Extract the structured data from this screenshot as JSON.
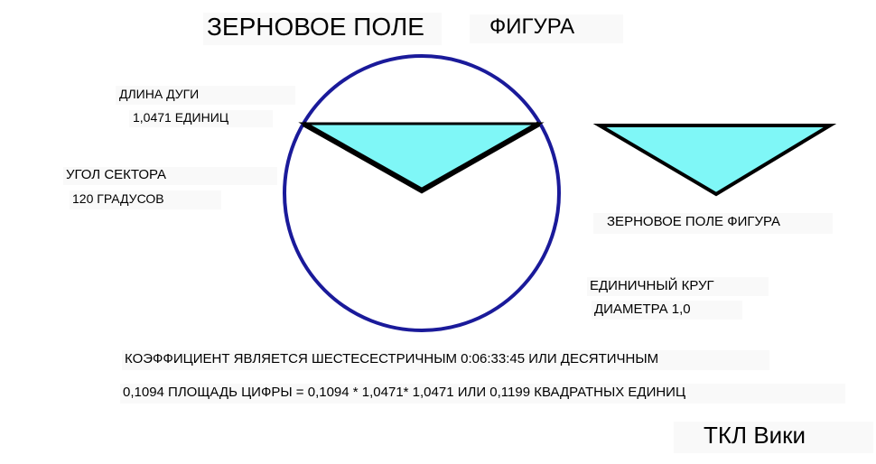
{
  "title": {
    "main": "ЗЕРНОВОЕ ПОЛЕ",
    "sub": "ФИГУРА"
  },
  "labels": {
    "arc_length_label": "ДЛИНА ДУГИ",
    "arc_length_value": "1,0471 ЕДИНИЦ",
    "sector_angle_label": "УГОЛ СЕКТОРА",
    "sector_angle_value": "120 ГРАДУСОВ",
    "figure_caption": "ЗЕРНОВОЕ ПОЛЕ ФИГУРА",
    "unit_circle_label": "ЕДИНИЧНЫЙ КРУГ",
    "diameter_label": "ДИАМЕТРА 1,0"
  },
  "text": {
    "coefficient_line": "КОЭФФИЦИЕНТ ЯВЛЯЕТСЯ ШЕСТЕСЕСТРИЧНЫМ 0:06:33:45 ИЛИ ДЕСЯТИЧНЫМ",
    "area_line": "0,1094 ПЛОЩАДЬ ЦИФРЫ = 0,1094 * 1,0471* 1,0471 ИЛИ 0,1199 КВАДРАТНЫХ ЕДИНИЦ"
  },
  "footer": {
    "signature": "ТКЛ Вики"
  },
  "colors": {
    "circle_stroke": "#1a1a9a",
    "triangle_fill": "#7ff7f7",
    "triangle_stroke": "#000000"
  }
}
